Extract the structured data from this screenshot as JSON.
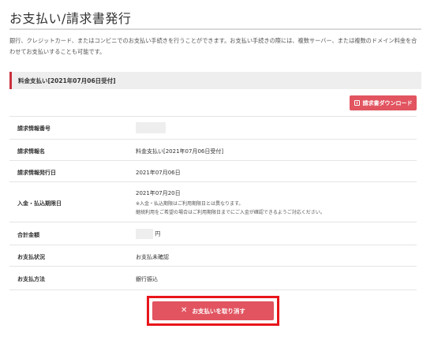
{
  "page": {
    "title": "お支払い/請求書発行",
    "intro": "銀行、クレジットカード、またはコンビニでのお支払い手続きを行うことができます。お支払い手続きの際には、複数サーバー、または複数のドメイン料金を合わせてお支払いすることも可能です。"
  },
  "section": {
    "header": "料金支払い[2021年07月06日受付]",
    "download_button": "請求書ダウンロード"
  },
  "rows": [
    {
      "label": "請求情報番号",
      "value": ""
    },
    {
      "label": "請求情報名",
      "value": "料金支払い[2021年07月06日受付]"
    },
    {
      "label": "請求情報発行日",
      "value": "2021年07月06日"
    },
    {
      "label": "入金・払込期限日",
      "value": "2021年07月20日",
      "note1": "※入金・払込期限はご利用期限日とは異なります。",
      "note2": "継続利用をご希望の場合はご利用期限日までにご入金が確認できるようご対応ください。"
    },
    {
      "label": "合計金額",
      "value": "",
      "unit": "円"
    },
    {
      "label": "お支払状況",
      "value": "お支払未確認"
    },
    {
      "label": "お支払方法",
      "value": "銀行振込"
    }
  ],
  "actions": {
    "cancel_button": "お支払いを取り消す"
  },
  "colors": {
    "accent": "#e15460",
    "highlight_border": "#e8151b",
    "section_bar": "#c9303b"
  }
}
